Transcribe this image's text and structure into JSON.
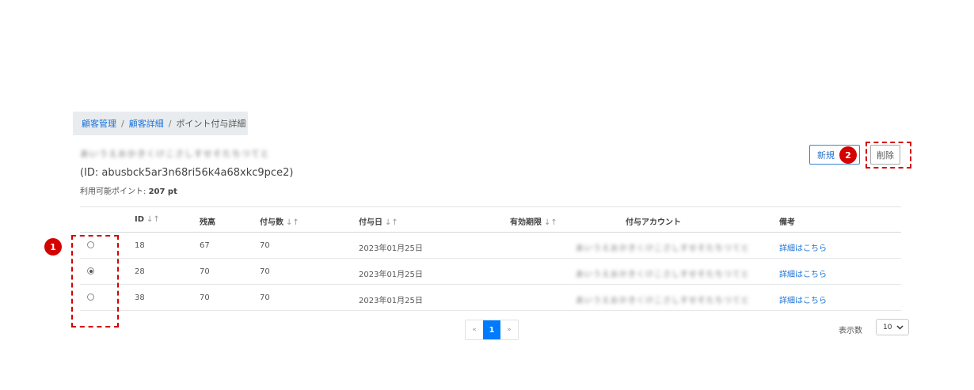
{
  "breadcrumb": {
    "items": [
      {
        "label": "顧客管理"
      },
      {
        "label": "顧客詳細"
      },
      {
        "label": "ポイント付与詳細"
      }
    ],
    "separator": "/"
  },
  "customer": {
    "name_blurred": "あいうえおかきくけこさしすせそたちつてと",
    "id_text": "(ID: abusbck5ar3n68ri56k4a68xkc9pce2)",
    "points_label": "利用可能ポイント:",
    "points_value": "207 pt"
  },
  "actions": {
    "new_label": "新規",
    "delete_label": "削除"
  },
  "annotations": {
    "badge1": "1",
    "badge2": "2",
    "color": "#d40000"
  },
  "table": {
    "columns": {
      "id": "ID",
      "balance": "残高",
      "granted": "付与数",
      "date": "付与日",
      "expiry": "有効期限",
      "account": "付与アカウント",
      "note": "備考"
    },
    "sort_icon": "↓↑",
    "rows": [
      {
        "selected": false,
        "id": "18",
        "balance": "67",
        "granted": "70",
        "date": "2023年01月25日",
        "expiry": "",
        "account": "あいうえおかきくけこさしすせそたちつてと",
        "note": "詳細はこちら"
      },
      {
        "selected": true,
        "id": "28",
        "balance": "70",
        "granted": "70",
        "date": "2023年01月25日",
        "expiry": "",
        "account": "あいうえおかきくけこさしすせそたちつてと",
        "note": "詳細はこちら"
      },
      {
        "selected": false,
        "id": "38",
        "balance": "70",
        "granted": "70",
        "date": "2023年01月25日",
        "expiry": "",
        "account": "あいうえおかきくけこさしすせそたちつてと",
        "note": "詳細はこちら"
      }
    ]
  },
  "pagination": {
    "prev": "«",
    "current": "1",
    "next": "»",
    "per_page_label": "表示数",
    "per_page_value": "10"
  },
  "colors": {
    "link": "#1a73d9",
    "primary": "#007bff",
    "annotation": "#d40000"
  }
}
